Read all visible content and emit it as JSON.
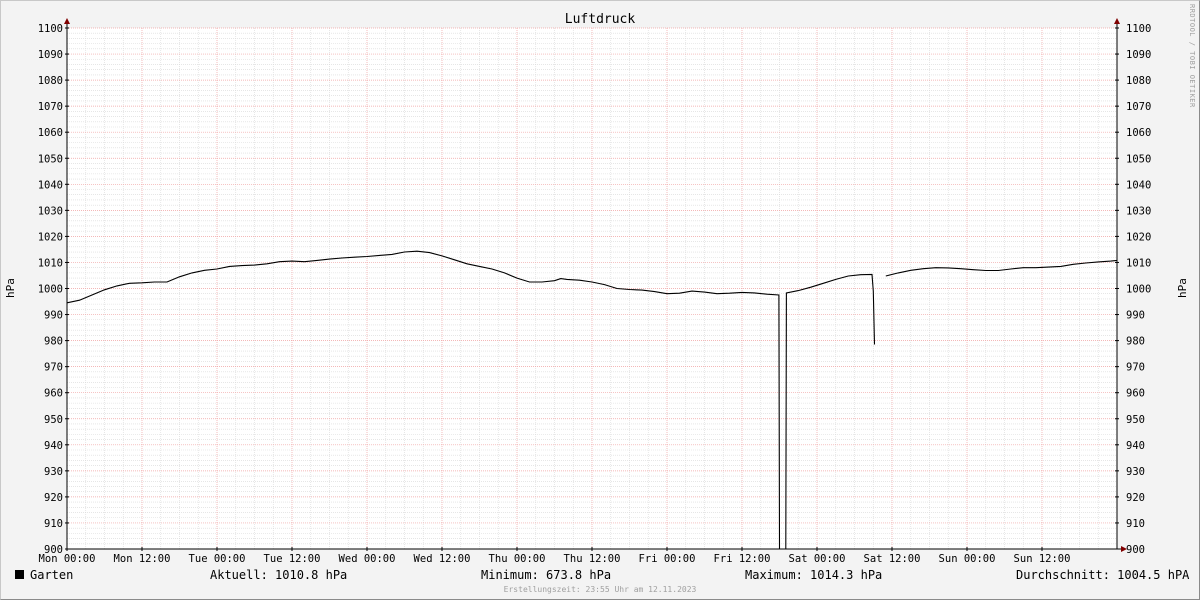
{
  "chart_data": {
    "type": "line",
    "title": "Luftdruck",
    "ylabel": "hPa",
    "ylabel_right": "hPa",
    "ylim": [
      900,
      1100
    ],
    "y_major_step": 10,
    "xlim": [
      "Mon 00:00",
      "Sun 24:00"
    ],
    "x_ticks": [
      "Mon 00:00",
      "Mon 12:00",
      "Tue 00:00",
      "Tue 12:00",
      "Wed 00:00",
      "Wed 12:00",
      "Thu 00:00",
      "Thu 12:00",
      "Fri 00:00",
      "Fri 12:00",
      "Sat 00:00",
      "Sat 12:00",
      "Sun 00:00",
      "Sun 12:00"
    ],
    "x_unit": "hours since Mon 00:00",
    "grid": true,
    "legend": "bottom-left",
    "series": [
      {
        "name": "Garten",
        "color": "#000000",
        "segments": [
          [
            [
              0,
              994.5
            ],
            [
              2,
              995.5
            ],
            [
              4,
              997.5
            ],
            [
              6,
              999.5
            ],
            [
              8,
              1001
            ],
            [
              10,
              1002
            ],
            [
              12,
              1002.2
            ],
            [
              14,
              1002.5
            ],
            [
              16,
              1002.5
            ],
            [
              18,
              1004.5
            ],
            [
              20,
              1006
            ],
            [
              22,
              1007
            ],
            [
              24,
              1007.5
            ],
            [
              26,
              1008.5
            ],
            [
              28,
              1008.8
            ],
            [
              30,
              1009
            ],
            [
              32,
              1009.5
            ],
            [
              34,
              1010.3
            ],
            [
              36,
              1010.5
            ],
            [
              38,
              1010.3
            ],
            [
              40,
              1010.8
            ],
            [
              42,
              1011.3
            ],
            [
              44,
              1011.7
            ],
            [
              46,
              1012
            ],
            [
              48,
              1012.3
            ],
            [
              50,
              1012.7
            ],
            [
              52,
              1013.1
            ],
            [
              54,
              1014
            ],
            [
              56,
              1014.3
            ],
            [
              58,
              1013.8
            ],
            [
              60,
              1012.5
            ],
            [
              62,
              1011
            ],
            [
              64,
              1009.5
            ],
            [
              66,
              1008.5
            ],
            [
              68,
              1007.5
            ],
            [
              70,
              1006
            ],
            [
              72,
              1004
            ],
            [
              74,
              1002.5
            ],
            [
              76,
              1002.5
            ],
            [
              78,
              1003
            ],
            [
              79,
              1003.8
            ],
            [
              80,
              1003.5
            ],
            [
              82,
              1003.2
            ],
            [
              84,
              1002.5
            ],
            [
              86,
              1001.5
            ],
            [
              88,
              1000
            ],
            [
              90,
              999.6
            ],
            [
              92,
              999.4
            ],
            [
              94,
              998.8
            ],
            [
              96,
              998
            ],
            [
              98,
              998.2
            ],
            [
              100,
              999
            ],
            [
              102,
              998.6
            ],
            [
              104,
              998
            ],
            [
              106,
              998.2
            ],
            [
              108,
              998.5
            ],
            [
              110,
              998.3
            ],
            [
              112,
              997.8
            ],
            [
              113.9,
              997.5
            ],
            [
              114,
              900
            ]
          ],
          [
            [
              115,
              900
            ],
            [
              115.1,
              998.3
            ],
            [
              117,
              999.2
            ],
            [
              119,
              1000.5
            ],
            [
              121,
              1002
            ],
            [
              123,
              1003.5
            ],
            [
              125,
              1004.8
            ],
            [
              127,
              1005.3
            ],
            [
              128.8,
              1005.4
            ],
            [
              129,
              999
            ],
            [
              129.2,
              978.5
            ]
          ],
          [
            [
              131,
              1004.8
            ],
            [
              133,
              1006
            ],
            [
              135,
              1007
            ],
            [
              137,
              1007.6
            ],
            [
              139,
              1008
            ],
            [
              141,
              1007.9
            ],
            [
              143,
              1007.6
            ],
            [
              145,
              1007.2
            ],
            [
              147,
              1006.9
            ],
            [
              149,
              1006.9
            ],
            [
              151,
              1007.5
            ],
            [
              153,
              1008
            ],
            [
              155,
              1008
            ],
            [
              157,
              1008.2
            ],
            [
              159,
              1008.5
            ],
            [
              161,
              1009.3
            ],
            [
              163,
              1009.8
            ],
            [
              165,
              1010.2
            ],
            [
              167,
              1010.5
            ],
            [
              168,
              1010.8
            ]
          ]
        ]
      }
    ]
  },
  "credit": "RRDTOOL / TOBI OETIKER",
  "legend": {
    "label": "Garten",
    "swatch_color": "#000000"
  },
  "stats": {
    "current": "Aktuell: 1010.8 hPa",
    "minimum": "Minimum: 673.8 hPa",
    "maximum": "Maximum: 1014.3 hPa",
    "average": "Durchschnitt: 1004.5 hPA"
  },
  "footer": "Erstellungszeit: 23:55 Uhr am 12.11.2023"
}
